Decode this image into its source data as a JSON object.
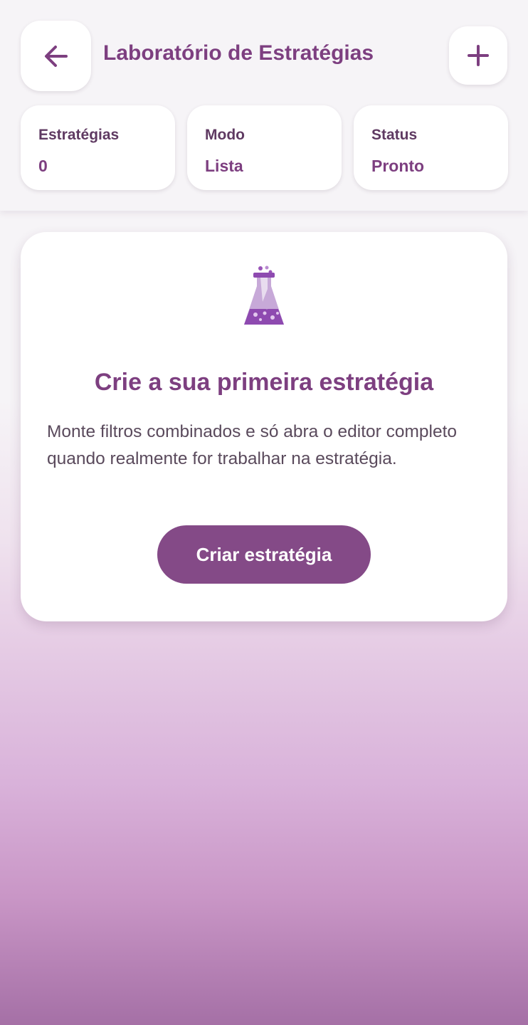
{
  "header": {
    "title": "Laboratório de Estratégias",
    "back_icon": "arrow-left-icon",
    "add_icon": "plus-icon"
  },
  "stats": [
    {
      "label": "Estratégias",
      "value": "0"
    },
    {
      "label": "Modo",
      "value": "Lista"
    },
    {
      "label": "Status",
      "value": "Pronto"
    }
  ],
  "empty_state": {
    "icon": "flask-icon",
    "title": "Crie a sua primeira estratégia",
    "description": "Monte filtros combinados e só abra o editor completo quando realmente for trabalhar na estratégia.",
    "button_label": "Criar estratégia"
  },
  "colors": {
    "accent": "#7d3f80",
    "button": "#844a87",
    "flask_purple": "#8e4ab0"
  }
}
